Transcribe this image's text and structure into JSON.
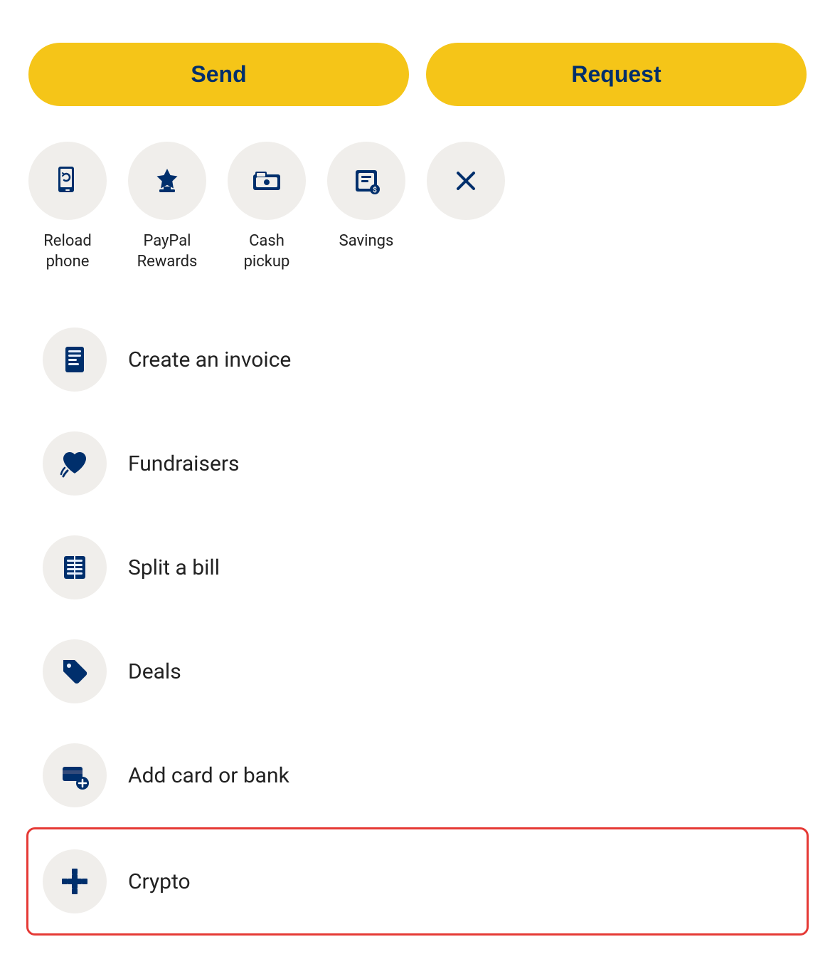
{
  "buttons": {
    "send": "Send",
    "request": "Request"
  },
  "accent_color": "#F5C518",
  "dark_blue": "#002F6C",
  "quick_actions": [
    {
      "id": "reload-phone",
      "label": "Reload\nphone",
      "label_display": "Reload phone"
    },
    {
      "id": "paypal-rewards",
      "label": "PayPal\nRewards",
      "label_display": "PayPal Rewards"
    },
    {
      "id": "cash-pickup",
      "label": "Cash\npickup",
      "label_display": "Cash pickup"
    },
    {
      "id": "savings",
      "label": "Savings",
      "label_display": "Savings"
    },
    {
      "id": "close",
      "label": "",
      "label_display": "Close"
    }
  ],
  "list_items": [
    {
      "id": "create-invoice",
      "label": "Create an invoice",
      "highlighted": false
    },
    {
      "id": "fundraisers",
      "label": "Fundraisers",
      "highlighted": false
    },
    {
      "id": "split-bill",
      "label": "Split a bill",
      "highlighted": false
    },
    {
      "id": "deals",
      "label": "Deals",
      "highlighted": false
    },
    {
      "id": "add-card-bank",
      "label": "Add card or bank",
      "highlighted": false
    },
    {
      "id": "crypto",
      "label": "Crypto",
      "highlighted": true
    }
  ]
}
